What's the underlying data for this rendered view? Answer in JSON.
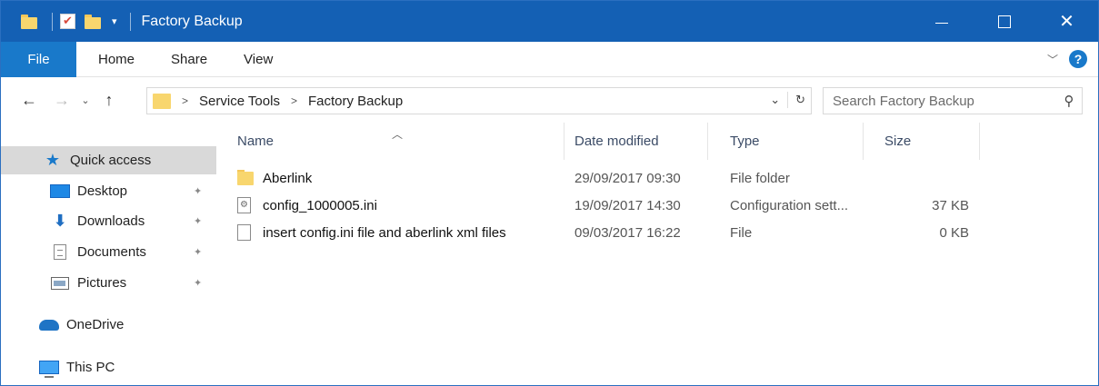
{
  "window": {
    "title": "Factory Backup",
    "accent": "#1460b4"
  },
  "ribbon": {
    "tabs": [
      {
        "label": "File"
      },
      {
        "label": "Home"
      },
      {
        "label": "Share"
      },
      {
        "label": "View"
      }
    ]
  },
  "address": {
    "crumbs": [
      "Service Tools",
      "Factory Backup"
    ]
  },
  "search": {
    "placeholder": "Search Factory Backup"
  },
  "sidebar": {
    "items": [
      {
        "label": "Quick access",
        "icon": "star-icon",
        "selected": true,
        "pinned": false
      },
      {
        "label": "Desktop",
        "icon": "desktop-icon",
        "pinned": true
      },
      {
        "label": "Downloads",
        "icon": "download-icon",
        "pinned": true
      },
      {
        "label": "Documents",
        "icon": "documents-icon",
        "pinned": true
      },
      {
        "label": "Pictures",
        "icon": "pictures-icon",
        "pinned": true
      },
      {
        "label": "OneDrive",
        "icon": "cloud-icon",
        "pinned": false
      },
      {
        "label": "This PC",
        "icon": "computer-icon",
        "pinned": false
      }
    ]
  },
  "columns": {
    "name": "Name",
    "date": "Date modified",
    "type": "Type",
    "size": "Size"
  },
  "files": [
    {
      "name": "Aberlink",
      "date": "29/09/2017 09:30",
      "type": "File folder",
      "size": "",
      "icon": "folder-icon"
    },
    {
      "name": "config_1000005.ini",
      "date": "19/09/2017 14:30",
      "type": "Configuration sett...",
      "size": "37 KB",
      "icon": "config-file-icon"
    },
    {
      "name": "insert config.ini file and aberlink xml files",
      "date": "09/03/2017 16:22",
      "type": "File",
      "size": "0 KB",
      "icon": "file-icon"
    }
  ]
}
